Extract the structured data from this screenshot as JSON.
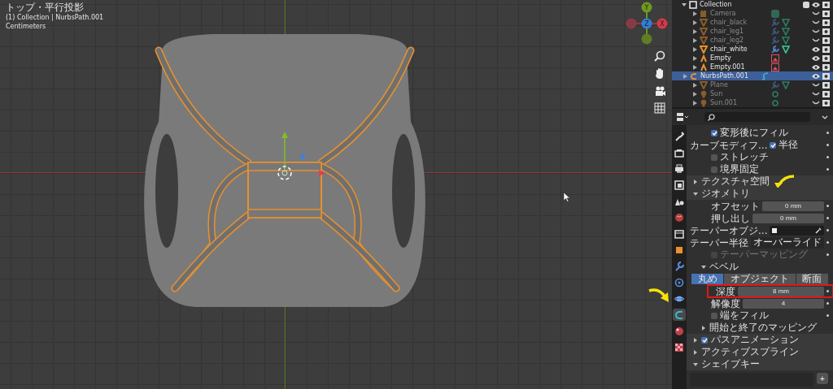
{
  "viewport": {
    "view_name": "トップ・平行投影",
    "collection_info": "(1) Collection | NurbsPath.001",
    "units": "Centimeters",
    "gizmo": [
      {
        "label": "Y",
        "kind": "y"
      },
      {
        "kind": "nx"
      },
      {
        "label": "Z",
        "kind": "z"
      },
      {
        "label": "X",
        "kind": "x"
      },
      {
        "kind": "ny"
      }
    ]
  },
  "outliner": {
    "collection": {
      "name": "Collection",
      "checked": true
    },
    "items": [
      {
        "name": "Camera",
        "kind": "camera",
        "visible": false,
        "selected": false
      },
      {
        "name": "chair_black",
        "kind": "mesh",
        "visible": false,
        "selected": false
      },
      {
        "name": "chair_leg1",
        "kind": "mesh",
        "visible": false,
        "selected": false
      },
      {
        "name": "chair_leg2",
        "kind": "mesh",
        "visible": false,
        "selected": false
      },
      {
        "name": "chair_white",
        "kind": "mesh",
        "visible": true,
        "selected": false
      },
      {
        "name": "Empty",
        "kind": "empty",
        "visible": true,
        "selected": false
      },
      {
        "name": "Empty.001",
        "kind": "empty",
        "visible": true,
        "selected": false
      },
      {
        "name": "NurbsPath.001",
        "kind": "curve",
        "visible": true,
        "selected": true
      },
      {
        "name": "Plane",
        "kind": "mesh",
        "visible": false,
        "selected": false
      },
      {
        "name": "Sun",
        "kind": "light",
        "visible": false,
        "selected": false
      },
      {
        "name": "Sun.001",
        "kind": "light",
        "visible": false,
        "selected": false
      }
    ]
  },
  "properties": {
    "tabs": [
      {
        "kind": "tool",
        "selected": false
      },
      {
        "kind": "render",
        "selected": false
      },
      {
        "kind": "output",
        "selected": false
      },
      {
        "kind": "view_layer",
        "selected": false
      },
      {
        "kind": "scene",
        "selected": false
      },
      {
        "kind": "world",
        "selected": false
      },
      {
        "kind": "collection",
        "selected": false
      },
      {
        "kind": "object",
        "selected": false
      },
      {
        "kind": "modifier",
        "selected": false
      },
      {
        "kind": "particles",
        "selected": false
      },
      {
        "kind": "physics",
        "selected": false
      },
      {
        "kind": "data",
        "selected": true
      },
      {
        "kind": "material",
        "selected": false
      },
      {
        "kind": "texture",
        "selected": false
      }
    ],
    "rows": [
      {
        "kind": "checkbox",
        "text": "変形後にフィル",
        "checked": true
      },
      {
        "kind": "checkbox",
        "label": "カーブモディフ...",
        "text": "半径",
        "checked": true
      },
      {
        "kind": "checkbox",
        "text": "ストレッチ",
        "checked": false
      },
      {
        "kind": "checkbox",
        "text": "境界固定",
        "checked": false
      },
      {
        "kind": "panel",
        "title": "テクスチャ空間",
        "expanded": false
      },
      {
        "kind": "panel",
        "title": "ジオメトリ",
        "expanded": true
      },
      {
        "kind": "number",
        "label": "オフセット",
        "value": "0 mm"
      },
      {
        "kind": "number",
        "label": "押し出し",
        "value": "0 mm"
      },
      {
        "kind": "object",
        "label": "テーパーオブジ..."
      },
      {
        "kind": "dropdown",
        "label": "テーパー半径",
        "value": "オーバーライド"
      },
      {
        "kind": "checkbox",
        "text": "テーパーマッピング",
        "checked": false,
        "disabled": true
      },
      {
        "kind": "subpanel",
        "title": "ベベル",
        "expanded": true
      },
      {
        "kind": "segmented",
        "options": [
          {
            "label": "丸め",
            "selected": true
          },
          {
            "label": "オブジェクト",
            "selected": false
          },
          {
            "label": "断面",
            "selected": false
          }
        ]
      },
      {
        "kind": "number",
        "label": "深度",
        "value": "8 mm",
        "highlighted": true
      },
      {
        "kind": "number",
        "label": "解像度",
        "value": "4"
      },
      {
        "kind": "checkbox",
        "text": "端をフィル",
        "checked": false
      },
      {
        "kind": "subpanel",
        "title": "開始と終了のマッピング",
        "expanded": false
      },
      {
        "kind": "panel",
        "title": "パスアニメーション",
        "expanded": false,
        "checked": true
      },
      {
        "kind": "panel",
        "title": "アクティブスプライン",
        "expanded": false
      },
      {
        "kind": "panel",
        "title": "シェイプキー",
        "expanded": true
      },
      {
        "kind": "list",
        "button": "+"
      }
    ]
  }
}
